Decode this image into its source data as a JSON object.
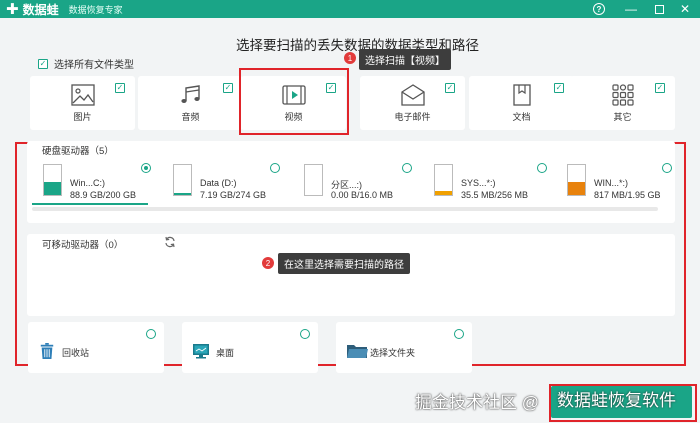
{
  "app": {
    "logo_text": "数据蛙",
    "subtitle": "数据恢复专家"
  },
  "colors": {
    "accent": "#1aa587",
    "annotation_red": "#e0242a",
    "callout_bg": "#3d3d3d"
  },
  "page": {
    "title": "选择要扫描的丢失数据的数据类型和路径",
    "select_all_label": "选择所有文件类型"
  },
  "callouts": [
    {
      "number": "1",
      "text": "选择扫描【视频】"
    },
    {
      "number": "2",
      "text": "在这里选择需要扫描的路径"
    }
  ],
  "file_types": [
    {
      "label": "图片",
      "icon": "image-icon",
      "checked": true
    },
    {
      "label": "音频",
      "icon": "music-icon",
      "checked": true
    },
    {
      "label": "视频",
      "icon": "video-icon",
      "checked": true
    },
    {
      "label": "电子邮件",
      "icon": "email-icon",
      "checked": true
    },
    {
      "label": "文档",
      "icon": "document-icon",
      "checked": true
    },
    {
      "label": "其它",
      "icon": "other-icon",
      "checked": true
    }
  ],
  "hard_drives": {
    "title": "硬盘驱动器（5）",
    "items": [
      {
        "name": "Win...C:)",
        "size": "88.9 GB/200 GB",
        "used_fraction": 0.44,
        "selected": true,
        "fill_color": "#1aa587"
      },
      {
        "name": "Data (D:)",
        "size": "7.19 GB/274 GB",
        "used_fraction": 0.03,
        "selected": false,
        "fill_color": "#1aa587"
      },
      {
        "name": "分区...:)",
        "size": "0.00 B/16.0 MB",
        "used_fraction": 0.0,
        "selected": false,
        "fill_color": "#e8a23a"
      },
      {
        "name": "SYS...*:)",
        "size": "35.5 MB/256 MB",
        "used_fraction": 0.14,
        "selected": false,
        "fill_color": "#f0a000"
      },
      {
        "name": "WIN...*:)",
        "size": "817 MB/1.95 GB",
        "used_fraction": 0.42,
        "selected": false,
        "fill_color": "#e8820c"
      }
    ]
  },
  "removable_drives": {
    "title": "可移动驱动器（0）"
  },
  "locations": [
    {
      "label": "回收站",
      "icon": "recycle-bin-icon"
    },
    {
      "label": "桌面",
      "icon": "desktop-icon"
    },
    {
      "label": "选择文件夹",
      "icon": "folder-icon"
    }
  ],
  "watermark": {
    "text": "掘金技术社区",
    "at": "@",
    "brand": "数据蛙恢复软件"
  }
}
